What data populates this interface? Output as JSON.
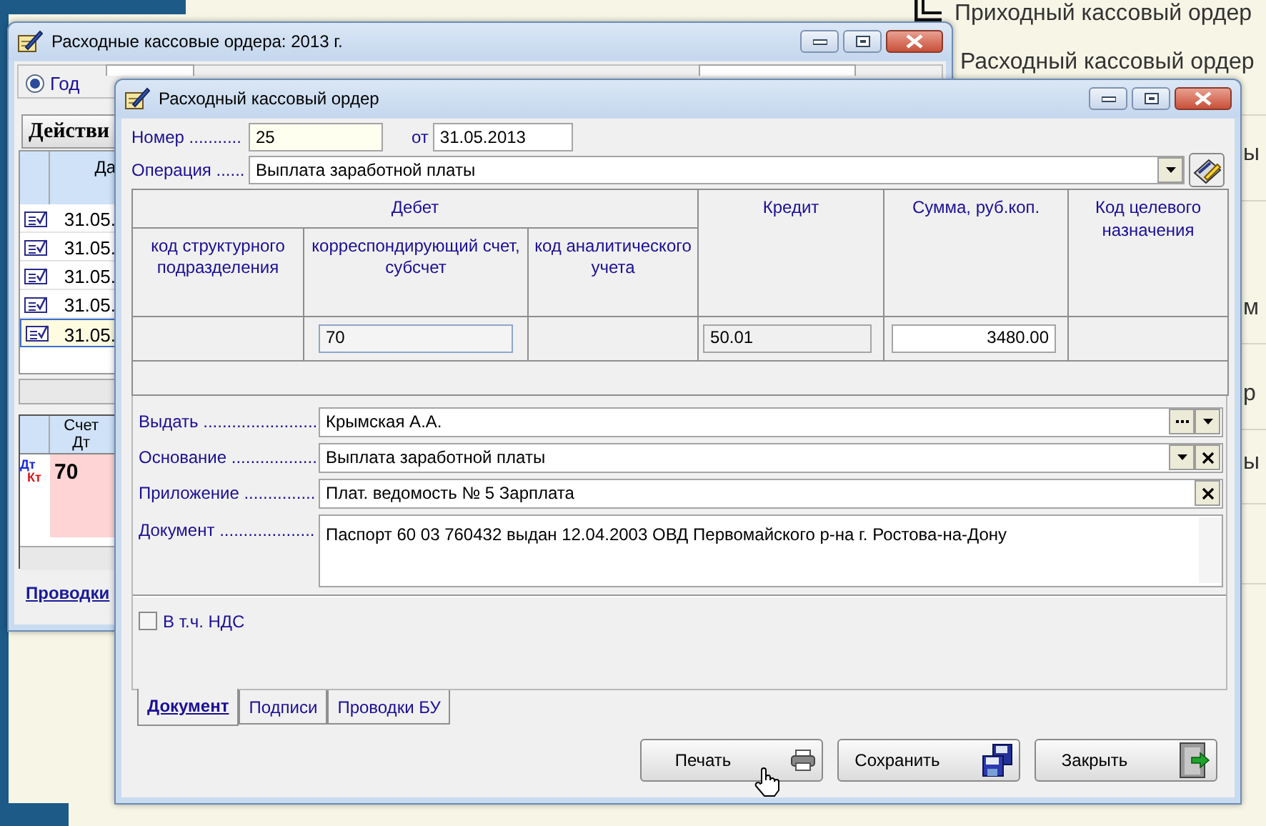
{
  "desktop": {
    "menu_items": [
      {
        "text": "Приходный кассовый ордер"
      },
      {
        "text": "Расходный кассовый ордер"
      }
    ],
    "cut_texts": [
      "ы",
      "м",
      "р",
      "ы"
    ]
  },
  "list_window": {
    "title": "Расходные кассовые ордера: 2013 г.",
    "period_radio": {
      "label": "Год",
      "selected": true
    },
    "actions_button": "Действи",
    "list_columns": [
      "Да"
    ],
    "list_rows": [
      {
        "date": "31.05.",
        "selected": false
      },
      {
        "date": "31.05.",
        "selected": false
      },
      {
        "date": "31.05.",
        "selected": false
      },
      {
        "date": "31.05.",
        "selected": false
      },
      {
        "date": "31.05.",
        "selected": true
      }
    ],
    "entries_columns": [
      "Счет Дт"
    ],
    "entries_rows": [
      {
        "debit_mark": "Дт",
        "credit_mark": "Кт",
        "account": "70"
      }
    ],
    "entries_link": "Проводки"
  },
  "order_window": {
    "title": "Расходный кассовый ордер",
    "number": {
      "label": "Номер ...........",
      "value": "25"
    },
    "date": {
      "label": "от",
      "value": "31.05.2013"
    },
    "operation": {
      "label": "Операция ......",
      "value": "Выплата  заработной платы"
    },
    "grid": {
      "debit_header": "Дебет",
      "debit_columns": [
        "код структурного подразделения",
        "корреспондирующий счет, субсчет",
        "код аналитического учета"
      ],
      "columns": [
        "Кредит",
        "Сумма, руб.коп.",
        "Код целевого назначения"
      ],
      "row": {
        "account": "70",
        "credit": "50.01",
        "amount": "3480.00"
      }
    },
    "fields": [
      {
        "kind": "lookup",
        "label": "Выдать .........................",
        "value": "Крымская А.А."
      },
      {
        "kind": "choice",
        "label": "Основание ..................",
        "value": "Выплата  заработной платы"
      },
      {
        "kind": "clearable",
        "label": "Приложение ...............",
        "value": "Плат. ведомость № 5 Зарплата"
      },
      {
        "kind": "memo",
        "label": "Документ ....................",
        "value": "Паспорт 60 03 760432 выдан 12.04.2003 ОВД Первомайского р-на  г. Ростова-на-Дону"
      }
    ],
    "vat_checkbox": {
      "label": "В т.ч. НДС",
      "checked": false
    },
    "tabs": [
      {
        "label": "Документ",
        "selected": true
      },
      {
        "label": "Подписи",
        "selected": false
      },
      {
        "label": "Проводки БУ",
        "selected": false
      }
    ],
    "buttons": [
      {
        "kind": "print",
        "label": "Печать"
      },
      {
        "kind": "save",
        "label": "Сохранить"
      },
      {
        "kind": "close",
        "label": "Закрыть"
      }
    ]
  }
}
